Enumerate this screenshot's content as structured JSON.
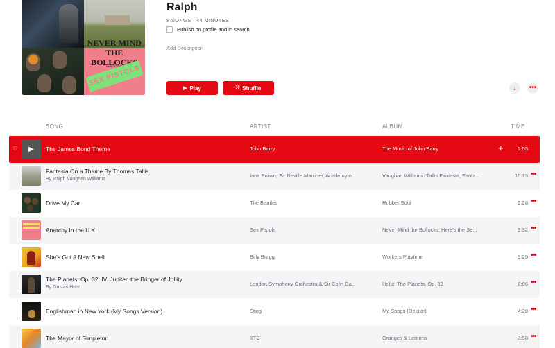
{
  "playlist": {
    "title": "Ralph",
    "meta": "8 SONGS · 44 MINUTES",
    "publish_label": "Publish on profile and in search",
    "add_description": "Add Description",
    "artwork": {
      "q1_lines": [
        "",
        "",
        "",
        "",
        "",
        "",
        "",
        ""
      ],
      "never_mind": "NEVER MIND",
      "the_bollocks": "THE BOLLOCKS",
      "heres_the": "HERE'S THE",
      "sex_pistols": "SEX PISTOLS"
    }
  },
  "buttons": {
    "play": "Play",
    "play_icon": "▶",
    "shuffle": "Shuffle",
    "shuffle_icon": "⤮",
    "download_icon": "↓",
    "more_icon": "•••"
  },
  "table": {
    "headers": {
      "song": "SONG",
      "artist": "ARTIST",
      "album": "ALBUM",
      "time": "TIME"
    },
    "rows": [
      {
        "song": "The James Bond Theme",
        "byline": "",
        "artist": "John Barry",
        "album": "The Music of John Barry",
        "time": "2:53",
        "state": "playing"
      },
      {
        "song": "Fantasia On a Theme By Thomas Tallis",
        "byline": "By Ralph Vaughan Williams",
        "artist": "Iona Brown, Sir Neville Marriner, Academy o...",
        "album": "Vaughan Williams: Tallis Fantasia, Fanta...",
        "time": "15:13"
      },
      {
        "song": "Drive My Car",
        "byline": "",
        "artist": "The Beatles",
        "album": "Rubber Soul",
        "time": "2:28"
      },
      {
        "song": "Anarchy In the U.K.",
        "byline": "",
        "artist": "Sex Pistols",
        "album": "Never Mind the Bollocks, Here's the Se...",
        "time": "3:32"
      },
      {
        "song": "She's Got A New Spell",
        "byline": "",
        "artist": "Billy Bragg",
        "album": "Workers Playtime",
        "time": "3:25"
      },
      {
        "song": "The Planets, Op. 32: IV. Jupiter, the Bringer of Jollity",
        "byline": "By Gustav Holst",
        "artist": "London Symphony Orchestra & Sir Colin Da...",
        "album": "Holst: The Planets, Op. 32",
        "time": "8:06"
      },
      {
        "song": "Englishman in New York (My Songs Version)",
        "byline": "",
        "artist": "Sting",
        "album": "My Songs (Deluxe)",
        "time": "4:28"
      },
      {
        "song": "The Mayor of Simpleton",
        "byline": "",
        "artist": "XTC",
        "album": "Oranges & Lemons",
        "time": "3:58"
      }
    ]
  },
  "icons": {
    "heart": "♡",
    "add": "+",
    "row_more": "•••",
    "play_small": "▶"
  },
  "colors": {
    "accent": "#e50914",
    "alt_row": "#f5f5f7",
    "secondary_text": "#6e6e73"
  }
}
